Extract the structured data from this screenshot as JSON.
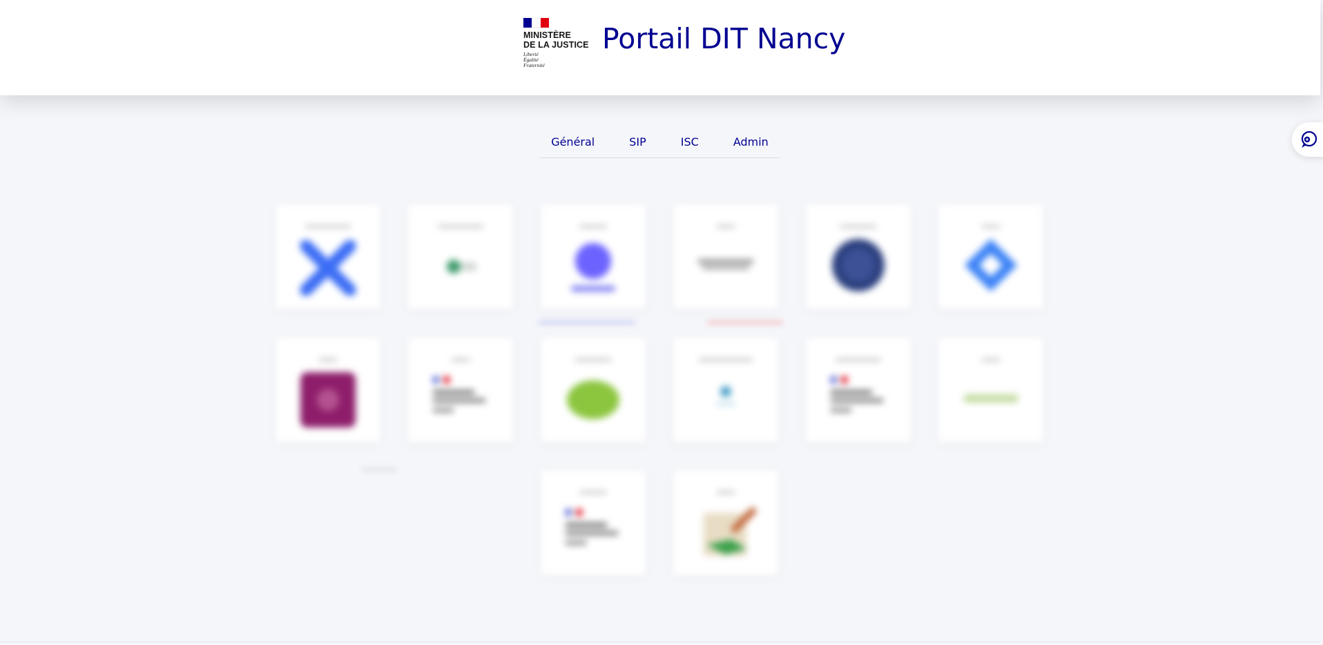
{
  "header": {
    "ministry_line1": "MINISTÈRE",
    "ministry_line2": "DE LA JUSTICE",
    "motto_1": "Liberté",
    "motto_2": "Égalité",
    "motto_3": "Fraternité",
    "title": "Portail DIT Nancy"
  },
  "tabs": [
    "Général",
    "SIP",
    "ISC",
    "Admin"
  ],
  "side_button": {
    "icon": "chat-help-icon"
  },
  "colors": {
    "accent": "#000091",
    "flag_blue": "#000091",
    "flag_white": "#ffffff",
    "flag_red": "#e1000f",
    "background": "#f5f6fa"
  }
}
